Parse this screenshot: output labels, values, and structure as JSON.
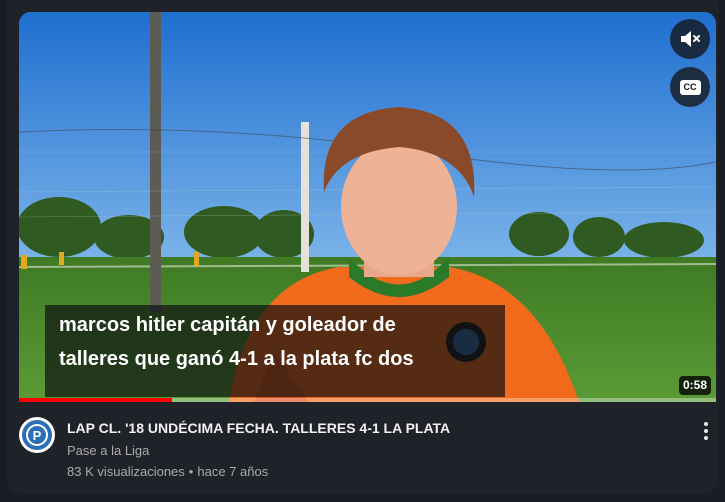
{
  "video": {
    "caption_line1": "marcos hitler capitán y goleador de",
    "caption_line2": "talleres que ganó 4-1 a la plata fc dos",
    "duration": "0:58",
    "progress": 0.22,
    "mute_icon": "volume-muted-icon",
    "cc_label": "CC"
  },
  "info": {
    "title": "LAP CL. '18 UNDÉCIMA FECHA. TALLERES 4-1 LA PLATA",
    "channel": "Pase a la Liga",
    "views": "83 K visualizaciones",
    "separator": "•",
    "age": "hace 7 años",
    "avatar_letter": "P"
  },
  "colors": {
    "progress": "#ff0000",
    "jersey": "#f26a1b",
    "sky": "#2e7fd6",
    "grass": "#4c8a2c",
    "avatar_ring": "#2b6fb6"
  }
}
